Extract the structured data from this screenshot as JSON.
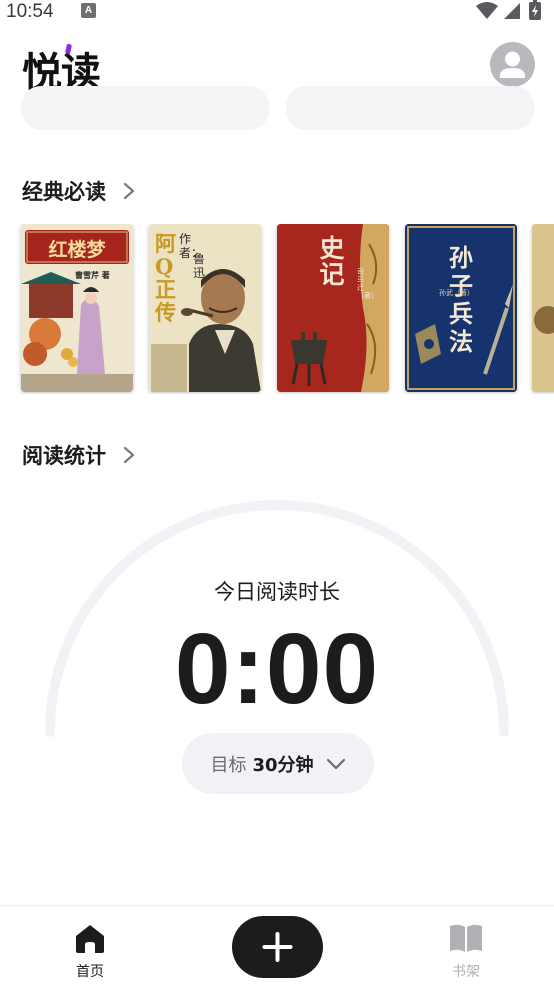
{
  "status_bar": {
    "time": "10:54",
    "a_badge": "A"
  },
  "header": {
    "logo_text": "悦读",
    "avatar_icon": "user-avatar-icon"
  },
  "sections": {
    "classics": {
      "title": "经典必读"
    },
    "stats": {
      "title": "阅读统计"
    }
  },
  "books": [
    {
      "title": "红楼梦",
      "author": "曹雪芹 著"
    },
    {
      "title": "阿Q正传",
      "author_prefix": "作者：",
      "author": "鲁迅"
    },
    {
      "title": "史记",
      "author": "司马迁（著）"
    },
    {
      "title": "孙子兵法",
      "author": "孙武（著）"
    }
  ],
  "reading": {
    "label": "今日阅读时长",
    "duration": "0:00",
    "goal_label": "目标",
    "goal_value": "30分钟"
  },
  "bottom_nav": {
    "home_label": "首页",
    "shelf_label": "书架",
    "add_icon": "plus-icon"
  },
  "colors": {
    "primary_dark": "#1c1c1e",
    "muted": "#b0b0b5",
    "track": "#f2f2f6",
    "accent_logo": "#8a2be2"
  }
}
